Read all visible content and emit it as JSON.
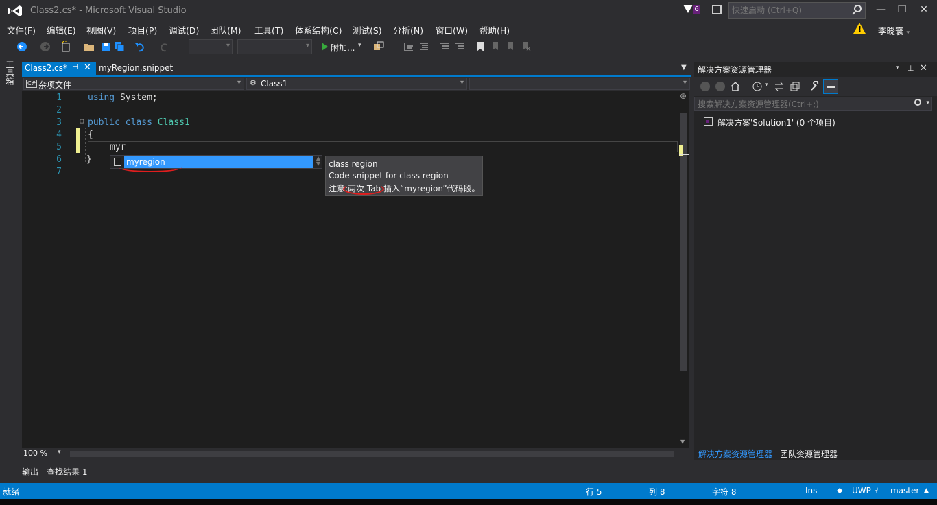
{
  "window": {
    "title": "Class2.cs* - Microsoft Visual Studio",
    "notification_count": "6",
    "quick_launch_placeholder": "快速启动 (Ctrl+Q)",
    "user_name": "李晓寰",
    "warning_symbol": "!"
  },
  "menu": [
    "文件(F)",
    "编辑(E)",
    "视图(V)",
    "项目(P)",
    "调试(D)",
    "团队(M)",
    "工具(T)",
    "体系结构(C)",
    "测试(S)",
    "分析(N)",
    "窗口(W)",
    "帮助(H)"
  ],
  "toolbar": {
    "attach_label": "附加...",
    "user_chevron": "▾"
  },
  "toolbox_label": "工具箱",
  "tabs": [
    {
      "label": "Class2.cs*",
      "active": true
    },
    {
      "label": "myRegion.snippet",
      "active": false
    }
  ],
  "navbar": {
    "project": "杂项文件",
    "project_badge": "C#",
    "type": "Class1"
  },
  "editor": {
    "lines": [
      {
        "num": "1",
        "text": "using System;"
      },
      {
        "num": "2",
        "text": ""
      },
      {
        "num": "3",
        "text": "public class Class1"
      },
      {
        "num": "4",
        "text": "{"
      },
      {
        "num": "5",
        "text": "myr"
      },
      {
        "num": "6",
        "text": "}"
      },
      {
        "num": "7",
        "text": ""
      }
    ],
    "collapse_marker": "⊟",
    "typed": "myr"
  },
  "completion": {
    "selected": "myregion"
  },
  "tooltip": {
    "title": "class region",
    "description": "Code snippet for class region",
    "note_prefix": "注意:",
    "note_keys": "两次 Tab",
    "note_suffix": "插入“myregion”代码段。"
  },
  "zoom": "100 %",
  "bottom_tabs": [
    "输出",
    "查找结果 1"
  ],
  "solution_explorer": {
    "title": "解决方案资源管理器",
    "search_placeholder": "搜索解决方案资源管理器(Ctrl+;)",
    "item": "解决方案'Solution1' (0 个项目)",
    "tabs": [
      "解决方案资源管理器",
      "团队资源管理器"
    ]
  },
  "status": {
    "ready": "就绪",
    "line": "行 5",
    "col": "列 8",
    "char": "字符 8",
    "ins": "Ins",
    "project": "UWP",
    "branch": "master"
  },
  "colors": {
    "accent": "#007acc",
    "selection": "#3399ff",
    "keyword": "#569cd6",
    "type": "#4ec9b0",
    "line_number": "#2b91af",
    "annotation": "#e01e1e"
  }
}
